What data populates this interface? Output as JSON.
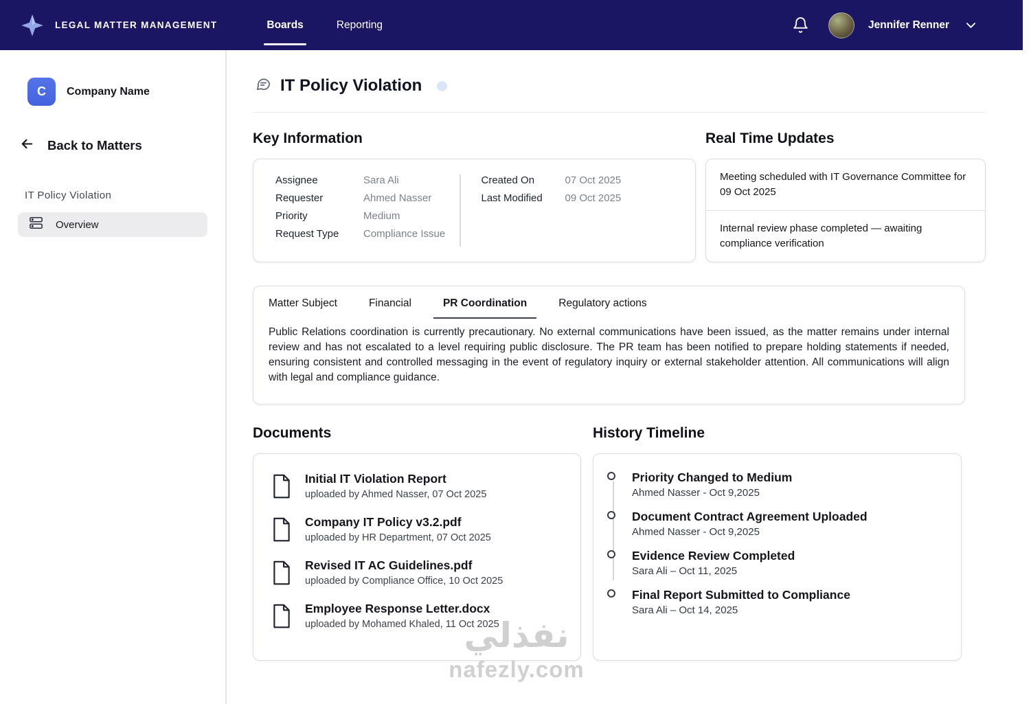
{
  "navbar": {
    "brand": "LEGAL MATTER MANAGEMENT",
    "tabs": [
      {
        "label": "Boards",
        "active": true
      },
      {
        "label": "Reporting",
        "active": false
      }
    ],
    "user": {
      "name": "Jennifer Renner"
    }
  },
  "sidebar": {
    "company": {
      "initial": "C",
      "name": "Company Name"
    },
    "back_label": "Back to Matters",
    "section_label": "IT Policy Violation",
    "items": [
      {
        "label": "Overview",
        "active": true
      }
    ]
  },
  "main": {
    "title": "IT Policy Violation",
    "key_information": {
      "heading": "Key Information",
      "fields": [
        {
          "label": "Assignee",
          "value": "Sara Ali"
        },
        {
          "label": "Requester",
          "value": "Ahmed Nasser"
        },
        {
          "label": "Priority",
          "value": "Medium"
        },
        {
          "label": "Request Type",
          "value": "Compliance Issue"
        }
      ],
      "dates": [
        {
          "label": "Created On",
          "value": "07 Oct 2025"
        },
        {
          "label": "Last Modified",
          "value": "09 Oct 2025"
        }
      ]
    },
    "real_time_updates": {
      "heading": "Real Time Updates",
      "items": [
        "Meeting scheduled with IT Governance Committee for 09 Oct 2025",
        "Internal review phase completed — awaiting compliance verification"
      ]
    },
    "tabs": {
      "items": [
        {
          "label": "Matter Subject",
          "active": false
        },
        {
          "label": "Financial",
          "active": false
        },
        {
          "label": "PR Coordination",
          "active": true
        },
        {
          "label": "Regulatory actions",
          "active": false
        }
      ],
      "content": "Public Relations coordination is currently precautionary. No external communications have been issued, as the matter remains under internal review and has not escalated to a level requiring public disclosure. The PR team has been notified to prepare holding statements if needed, ensuring consistent and controlled messaging in the event of regulatory inquiry or external stakeholder attention. All communications will align with legal and compliance guidance."
    },
    "documents": {
      "heading": "Documents",
      "items": [
        {
          "title": "Initial IT Violation Report",
          "meta": "uploaded by Ahmed Nasser, 07 Oct 2025"
        },
        {
          "title": "Company IT Policy v3.2.pdf",
          "meta": "uploaded by HR Department, 07 Oct 2025"
        },
        {
          "title": "Revised IT AC Guidelines.pdf",
          "meta": "uploaded by Compliance Office, 10 Oct 2025"
        },
        {
          "title": "Employee Response Letter.docx",
          "meta": "uploaded by Mohamed Khaled, 11 Oct 2025"
        }
      ]
    },
    "history": {
      "heading": "History Timeline",
      "items": [
        {
          "title": "Priority Changed to Medium",
          "meta": "Ahmed Nasser - Oct 9,2025"
        },
        {
          "title": "Document Contract Agreement Uploaded",
          "meta": "Ahmed Nasser - Oct 9,2025"
        },
        {
          "title": "Evidence Review Completed",
          "meta": "Sara Ali – Oct 11, 2025"
        },
        {
          "title": "Final Report Submitted to Compliance",
          "meta": "Sara Ali – Oct 14, 2025"
        }
      ]
    }
  },
  "watermark": {
    "arabic": "نفذلي",
    "latin": "nafezly.com"
  },
  "colors": {
    "navbar": "#1b1663",
    "company_avatar": "#4b6bdd",
    "status_dot": "#d9e6f7"
  }
}
